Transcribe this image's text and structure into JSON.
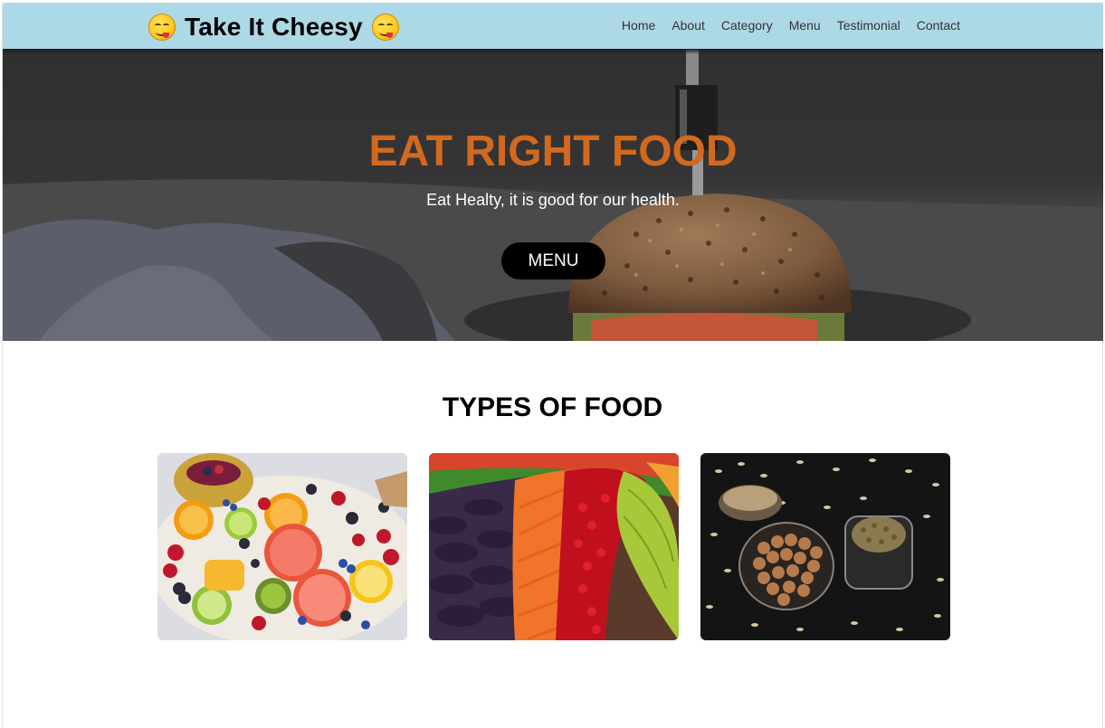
{
  "header": {
    "brand": "Take It Cheesy",
    "nav": [
      "Home",
      "About",
      "Category",
      "Menu",
      "Testimonial",
      "Contact"
    ]
  },
  "hero": {
    "title": "EAT RIGHT FOOD",
    "subtitle": "Eat Healty, it is good for our health.",
    "button": "MENU"
  },
  "types": {
    "title": "TYPES OF FOOD",
    "images": [
      "fruits-image",
      "vegetables-image",
      "grains-image"
    ]
  },
  "colors": {
    "nav_bg": "#add8e6",
    "hero_title": "#d2691e",
    "button_bg": "#000000"
  }
}
